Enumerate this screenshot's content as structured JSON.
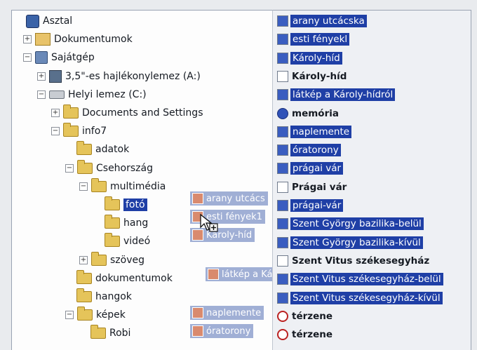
{
  "tree": [
    {
      "label": "Asztal",
      "icon": "desktop-icon",
      "expander": ""
    },
    {
      "label": "Dokumentumok",
      "icon": "my-documents-icon",
      "expander": "+"
    },
    {
      "label": "Sajátgép",
      "icon": "my-computer-icon",
      "expander": "−"
    },
    {
      "label": "3,5\"-es hajlékonylemez (A:)",
      "icon": "floppy-drive-icon",
      "expander": "+"
    },
    {
      "label": "Helyi lemez (C:)",
      "icon": "hard-drive-icon",
      "expander": "−"
    },
    {
      "label": "Documents and Settings",
      "icon": "folder-icon",
      "expander": "+"
    },
    {
      "label": "info7",
      "icon": "folder-icon",
      "expander": "−"
    },
    {
      "label": "adatok",
      "icon": "folder-icon",
      "expander": ""
    },
    {
      "label": "Csehország",
      "icon": "folder-icon",
      "expander": "−"
    },
    {
      "label": "multimédia",
      "icon": "folder-icon",
      "expander": "−"
    },
    {
      "label": "fotó",
      "icon": "folder-icon",
      "expander": "",
      "selected": true
    },
    {
      "label": "hang",
      "icon": "folder-icon",
      "expander": ""
    },
    {
      "label": "videó",
      "icon": "folder-icon",
      "expander": ""
    },
    {
      "label": "szöveg",
      "icon": "folder-icon",
      "expander": "+"
    },
    {
      "label": "dokumentumok",
      "icon": "folder-icon",
      "expander": ""
    },
    {
      "label": "hangok",
      "icon": "folder-icon",
      "expander": ""
    },
    {
      "label": "képek",
      "icon": "folder-icon",
      "expander": "−"
    },
    {
      "label": "Robi",
      "icon": "folder-icon",
      "expander": ""
    }
  ],
  "drag_ghost": [
    "arany utcács",
    "esti fények1",
    "Károly-híd",
    "látkép a Káro",
    "naplemente",
    "óratorony"
  ],
  "files": [
    {
      "label": "arany utcácska",
      "type": "image",
      "selected": true
    },
    {
      "label": "esti fényekl",
      "type": "image",
      "selected": true
    },
    {
      "label": "Károly-híd",
      "type": "image",
      "selected": true
    },
    {
      "label": "Károly-híd",
      "type": "document",
      "selected": false
    },
    {
      "label": "látkép a Károly-hídról",
      "type": "image",
      "selected": true
    },
    {
      "label": "memória",
      "type": "sound",
      "selected": false
    },
    {
      "label": "naplemente",
      "type": "image",
      "selected": true
    },
    {
      "label": "óratorony",
      "type": "image",
      "selected": true
    },
    {
      "label": "prágai vár",
      "type": "image",
      "selected": true
    },
    {
      "label": "Prágai vár",
      "type": "document",
      "selected": false
    },
    {
      "label": "prágai-vár",
      "type": "image",
      "selected": true
    },
    {
      "label": "Szent György bazilika-belül",
      "type": "image",
      "selected": true
    },
    {
      "label": "Szent György bazilika-kívül",
      "type": "image",
      "selected": true
    },
    {
      "label": "Szent Vitus székesegyház",
      "type": "text",
      "selected": false
    },
    {
      "label": "Szent Vitus székesegyház-belül",
      "type": "image",
      "selected": true
    },
    {
      "label": "Szent Vitus székesegyház-kívül",
      "type": "image",
      "selected": true
    },
    {
      "label": "térzene",
      "type": "web",
      "selected": false
    },
    {
      "label": "térzene",
      "type": "web",
      "selected": false
    }
  ]
}
